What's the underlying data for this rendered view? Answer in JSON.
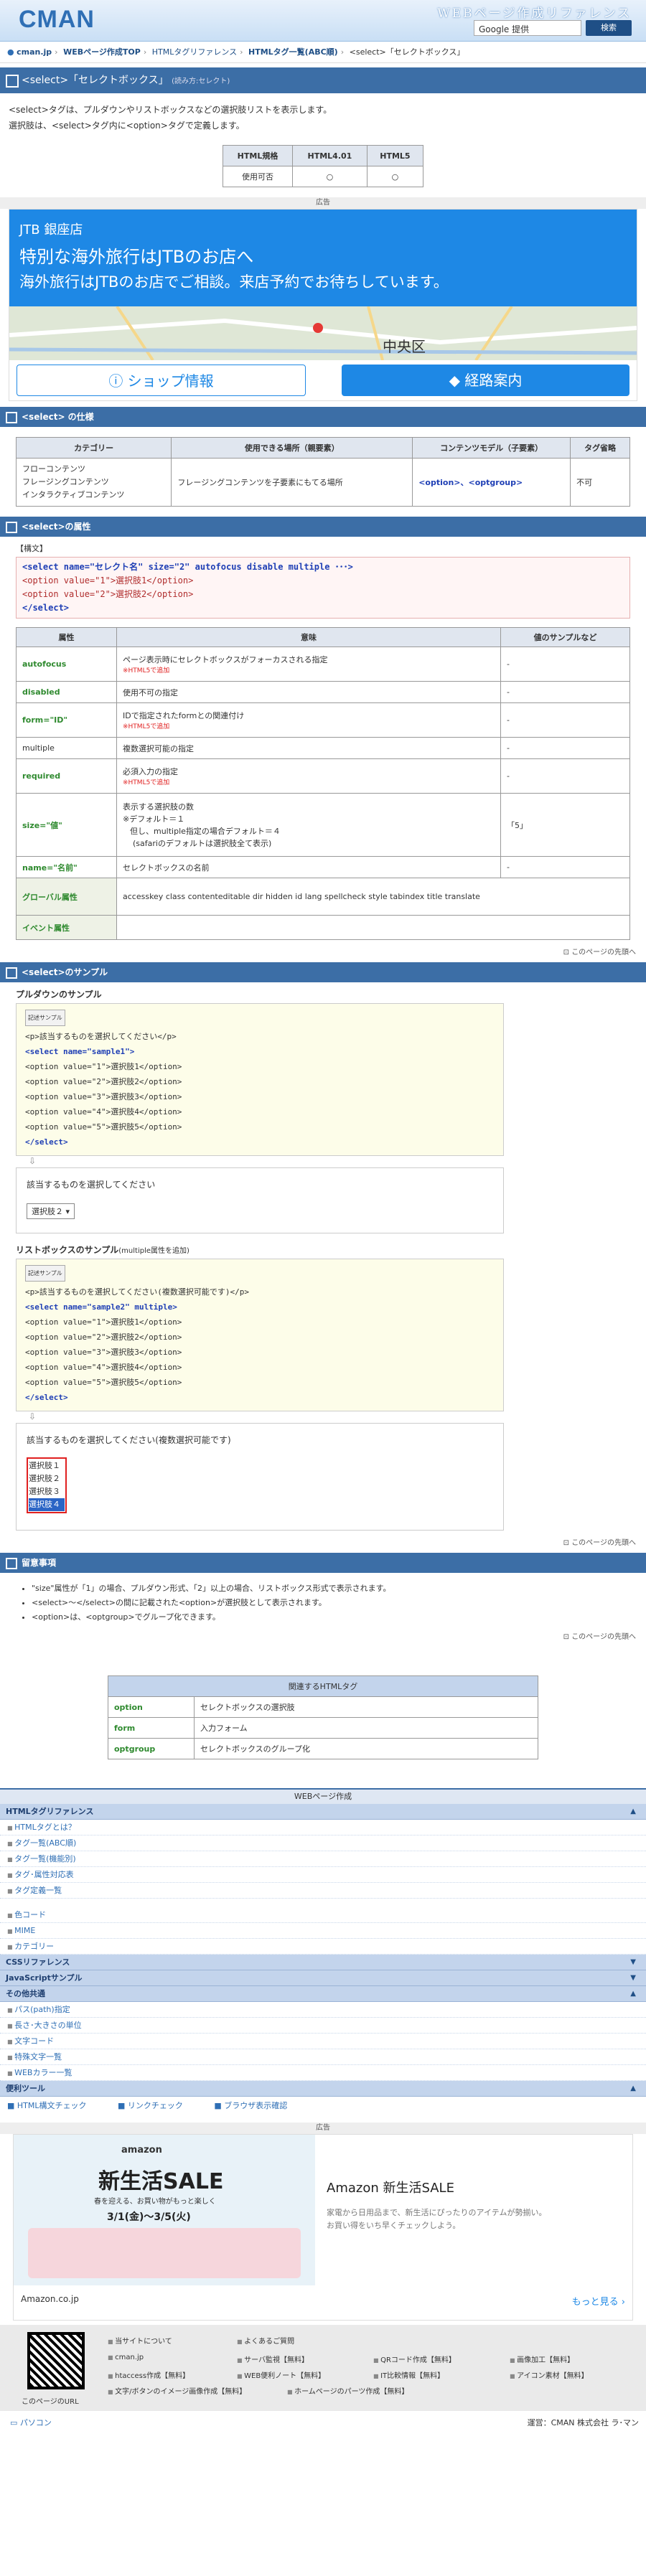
{
  "header": {
    "logo": "CMAN",
    "site_title": "WEBページ作成リファレンス",
    "search_placeholder": "Google 提供",
    "search_button": "検索"
  },
  "breadcrumb": {
    "items": [
      "cman.jp",
      "WEBページ作成TOP",
      "HTMLタグリファレンス",
      "HTMLタグ一覧(ABC順)",
      "<select>「セレクトボックス」"
    ]
  },
  "title": {
    "text": "<select>「セレクトボックス」",
    "reading": "(読み方:セレクト)"
  },
  "intro": {
    "line1": "<select>タグは、プルダウンやリストボックスなどの選択肢リストを表示します。",
    "line2": "選択肢は、<select>タグ内に<option>タグで定義します。"
  },
  "support": {
    "headers": [
      "HTML規格",
      "HTML4.01",
      "HTML5"
    ],
    "row": [
      "使用可否",
      "○",
      "○"
    ]
  },
  "ad1": {
    "label": "広告",
    "brand": "JTB 銀座店",
    "headline": "特別な海外旅行はJTBのお店へ",
    "sub": "海外旅行はJTBのお店でご相談。来店予約でお待ちしています。",
    "map_label": "中央区",
    "btn_info": "ショップ情報",
    "btn_route": "経路案内"
  },
  "spec": {
    "section": "<select> の仕様",
    "headers": [
      "カテゴリー",
      "使用できる場所（親要素）",
      "コンテンツモデル（子要素）",
      "タグ省略"
    ],
    "categories": [
      "フローコンテンツ",
      "フレージングコンテンツ",
      "インタラクティブコンテンツ"
    ],
    "parent": "フレージングコンテンツを子要素にもてる場所",
    "content": "<option>、<optgroup>",
    "omit": "不可"
  },
  "attrsec": {
    "section": "<select>の属性",
    "syntax_label": "【構文】",
    "code": [
      "<select name=\"セレクト名\" size=\"2\" autofocus disable multiple ･･･>",
      "<option value=\"1\">選択肢1</option>",
      "<option value=\"2\">選択肢2</option>",
      "</select>"
    ],
    "headers": [
      "属性",
      "意味",
      "値のサンプルなど"
    ],
    "rows": [
      {
        "name": "autofocus",
        "mean": "ページ表示時にセレクトボックスがフォーカスされる指定",
        "note": "※HTML5で追加",
        "val": "-"
      },
      {
        "name": "disabled",
        "mean": "使用不可の指定",
        "note": "",
        "val": "-"
      },
      {
        "name": "form=\"ID\"",
        "mean": "IDで指定されたformとの関連付け",
        "note": "※HTML5で追加",
        "val": "-"
      },
      {
        "name": "multiple",
        "mean": "複数選択可能の指定",
        "note": "",
        "val": "-"
      },
      {
        "name": "required",
        "mean": "必須入力の指定",
        "note": "※HTML5で追加",
        "val": "-"
      },
      {
        "name": "size=\"値\"",
        "mean": "表示する選択肢の数",
        "note": "",
        "val": "「5」"
      },
      {
        "name": "name=\"名前\"",
        "mean": "セレクトボックスの名前",
        "note": "",
        "val": "-"
      }
    ],
    "size_extra": [
      "※デフォルト＝１",
      "但し、multiple指定の場合デフォルト＝４",
      "(safariのデフォルトは選択肢全て表示)"
    ],
    "global_label": "グローバル属性",
    "global_list": "accesskey class contenteditable dir hidden id lang spellcheck style tabindex title translate",
    "event_label": "イベント属性"
  },
  "pagetop": "このページの先頭へ",
  "samples": {
    "section": "<select>のサンプル",
    "pulldown_title": "プルダウンのサンプル",
    "tag_label": "記述サンプル",
    "code1": [
      "<p>該当するものを選択してください</p>",
      "<select name=\"sample1\">",
      "<option value=\"1\">選択肢1</option>",
      "<option value=\"2\">選択肢2</option>",
      "<option value=\"3\">選択肢3</option>",
      "<option value=\"4\">選択肢4</option>",
      "<option value=\"5\">選択肢5</option>",
      "</select>"
    ],
    "prompt1": "該当するものを選択してください",
    "selected1": "選択肢２",
    "listbox_title": "リストボックスのサンプル",
    "listbox_note": "(multiple属性を追加)",
    "code2": [
      "<p>該当するものを選択してください(複数選択可能です)</p>",
      "<select name=\"sample2\" multiple>",
      "<option value=\"1\">選択肢1</option>",
      "<option value=\"2\">選択肢2</option>",
      "<option value=\"3\">選択肢3</option>",
      "<option value=\"4\">選択肢4</option>",
      "<option value=\"5\">選択肢5</option>",
      "</select>"
    ],
    "prompt2": "該当するものを選択してください(複数選択可能です)",
    "options2": [
      "選択肢１",
      "選択肢２",
      "選択肢３",
      "選択肢４"
    ]
  },
  "notes": {
    "section": "留意事項",
    "items": [
      "\"size\"属性が「1」の場合、プルダウン形式、「2」以上の場合、リストボックス形式で表示されます。",
      "<select>～</select>の間に記載された<option>が選択肢として表示されます。",
      "<option>は、<optgroup>でグループ化できます。"
    ]
  },
  "related": {
    "title": "関連するHTMLタグ",
    "rows": [
      [
        "option",
        "セレクトボックスの選択肢"
      ],
      [
        "form",
        "入力フォーム"
      ],
      [
        "optgroup",
        "セレクトボックスのグループ化"
      ]
    ]
  },
  "menu": {
    "title": "WEBページ作成",
    "groups": [
      {
        "label": "HTMLタグリファレンス",
        "items": [
          "HTMLタグとは？",
          "タグ一覧(ABC順)",
          "タグ一覧(機能別)",
          "タグ･属性対応表",
          "タグ定義一覧",
          "",
          "色コード",
          "MIME",
          "カテゴリー"
        ]
      },
      {
        "label": "CSSリファレンス",
        "items": []
      },
      {
        "label": "JavaScriptサンプル",
        "items": []
      },
      {
        "label": "その他共通",
        "items": [
          "パス(path)指定",
          "長さ･大きさの単位",
          "文字コード",
          "特殊文字一覧",
          "WEBカラー一覧"
        ]
      },
      {
        "label": "便利ツール",
        "items": [
          "HTML構文チェック",
          "リンクチェック",
          "ブラウザ表示確認"
        ]
      }
    ]
  },
  "ad2": {
    "label": "広告",
    "brand": "amazon",
    "sale": "新生活SALE",
    "sub": "春を迎える、お買い物がもっと楽しく",
    "dates": "3/1(金)～3/5(火)",
    "title": "Amazon 新生活SALE",
    "desc1": "家電から日用品まで、新生活にぴったりのアイテムが勢揃い。",
    "desc2": "お買い得をいち早くチェックしよう。",
    "domain": "Amazon.co.jp",
    "more": "もっと見る ›"
  },
  "footer": {
    "links": [
      "当サイトについて",
      "よくあるご質問",
      "cman.jp",
      "サーバ監視【無料】",
      "QRコード作成【無料】",
      "画像加工【無料】",
      "htaccess作成【無料】",
      "WEB便利ノート【無料】",
      "IT比較情報【無料】",
      "アイコン素材【無料】",
      "文字/ボタンのイメージ画像作成【無料】",
      "ホームページのパーツ作成【無料】"
    ],
    "url_label": "このページのURL",
    "pc": "パソコン",
    "company": "運営：CMAN 株式会社 ラ･マン"
  },
  "colors": {
    "primary": "#3c6ea6",
    "accent": "#1f4f86"
  }
}
